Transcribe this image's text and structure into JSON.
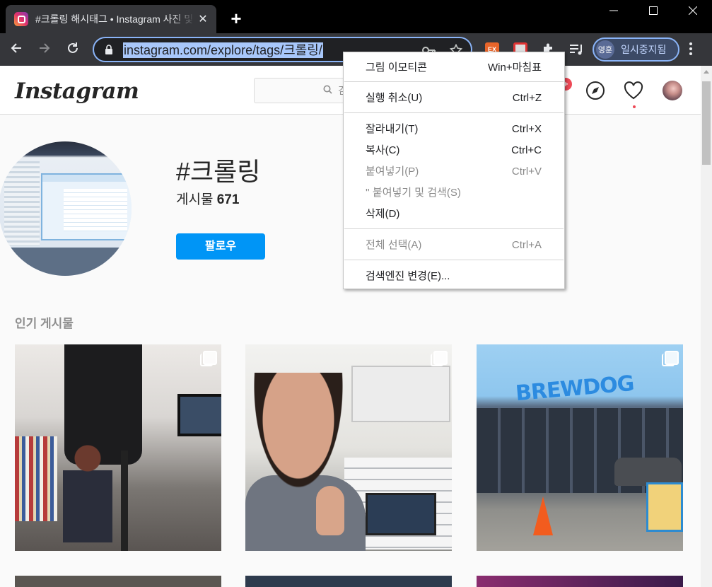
{
  "browser": {
    "tab_title": "#크롤링 해시태그 • Instagram 사진 및 동영상",
    "tab_close": "✕",
    "new_tab": "+",
    "url": "instagram.com/explore/tags/크롤링/",
    "profile_avatar": "영훈",
    "profile_label": "일시중지됨",
    "ext_label": "EX",
    "icons": [
      "back-icon",
      "forward-icon",
      "reload-icon",
      "lock-icon",
      "key-icon",
      "star-icon",
      "extensions-icon",
      "media-icon",
      "menu-icon"
    ],
    "accent_color": "#8ab4f8"
  },
  "instagram": {
    "logo": "Instagram",
    "search_placeholder": "검",
    "notification_count": "+",
    "hashtag": "#크롤링",
    "posts_label": "게시물",
    "posts_count": "671",
    "follow_label": "팔로우",
    "section_title": "인기 게시물",
    "brand_color": "#0095f6",
    "post_sign_text": "BREWDOG"
  },
  "context_menu": {
    "items": [
      {
        "label": "그림 이모티콘",
        "shortcut": "Win+마침표",
        "disabled": false
      },
      {
        "label": "실행 취소(U)",
        "shortcut": "Ctrl+Z",
        "disabled": false
      },
      {
        "label": "잘라내기(T)",
        "shortcut": "Ctrl+X",
        "disabled": false
      },
      {
        "label": "복사(C)",
        "shortcut": "Ctrl+C",
        "disabled": false
      },
      {
        "label": "붙여넣기(P)",
        "shortcut": "Ctrl+V",
        "disabled": true
      },
      {
        "label": "'' 붙여넣기 및 검색(S)",
        "shortcut": "",
        "disabled": true
      },
      {
        "label": "삭제(D)",
        "shortcut": "",
        "disabled": false
      },
      {
        "label": "전체 선택(A)",
        "shortcut": "Ctrl+A",
        "disabled": true
      },
      {
        "label": "검색엔진 변경(E)...",
        "shortcut": "",
        "disabled": false
      }
    ]
  }
}
